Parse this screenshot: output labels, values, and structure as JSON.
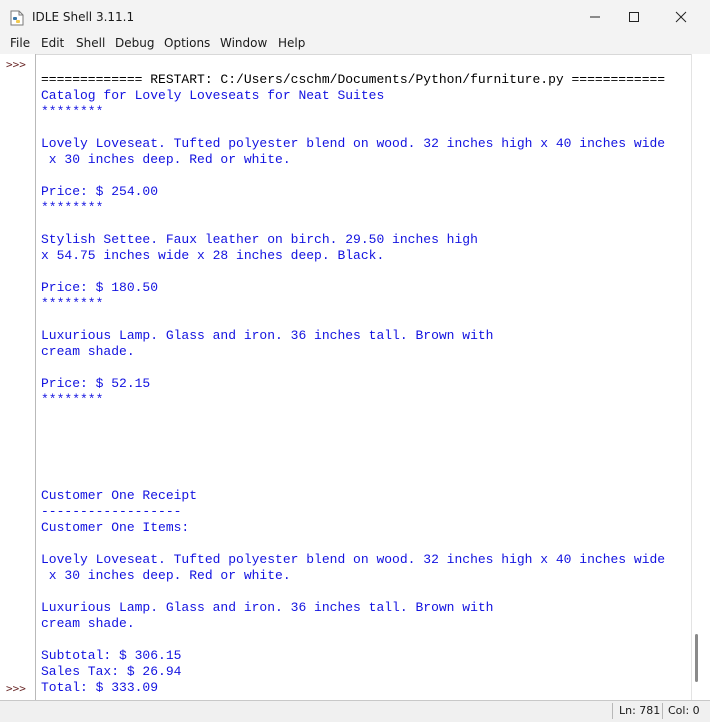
{
  "window": {
    "title": "IDLE Shell 3.11.1",
    "icons": {
      "app": "idle-python-icon",
      "minimize": "minimize-icon",
      "maximize": "maximize-icon",
      "close": "close-icon"
    }
  },
  "menu": [
    "File",
    "Edit",
    "Shell",
    "Debug",
    "Options",
    "Window",
    "Help"
  ],
  "prompts": [
    ">>>",
    ">>>"
  ],
  "shell": {
    "restart_line": "============= RESTART: C:/Users/cschm/Documents/Python/furniture.py ============",
    "output": [
      "Catalog for Lovely Loveseats for Neat Suites",
      "********",
      "",
      "Lovely Loveseat. Tufted polyester blend on wood. 32 inches high x 40 inches wide",
      " x 30 inches deep. Red or white.",
      "",
      "Price: $ 254.00",
      "********",
      "",
      "Stylish Settee. Faux leather on birch. 29.50 inches high",
      "x 54.75 inches wide x 28 inches deep. Black.",
      "",
      "Price: $ 180.50",
      "********",
      "",
      "Luxurious Lamp. Glass and iron. 36 inches tall. Brown with",
      "cream shade.",
      "",
      "Price: $ 52.15",
      "********",
      "",
      "",
      "",
      "",
      "",
      "Customer One Receipt",
      "------------------",
      "Customer One Items:",
      "",
      "Lovely Loveseat. Tufted polyester blend on wood. 32 inches high x 40 inches wide",
      " x 30 inches deep. Red or white.",
      "",
      "Luxurious Lamp. Glass and iron. 36 inches tall. Brown with",
      "cream shade.",
      "",
      "Subtotal: $ 306.15",
      "Sales Tax: $ 26.94",
      "Total: $ 333.09"
    ]
  },
  "status": {
    "line": "Ln: 781",
    "col": "Col: 0"
  },
  "colors": {
    "output_text": "#1212e0",
    "restart_text": "#000000",
    "prompt_text": "#6b2a2a"
  }
}
